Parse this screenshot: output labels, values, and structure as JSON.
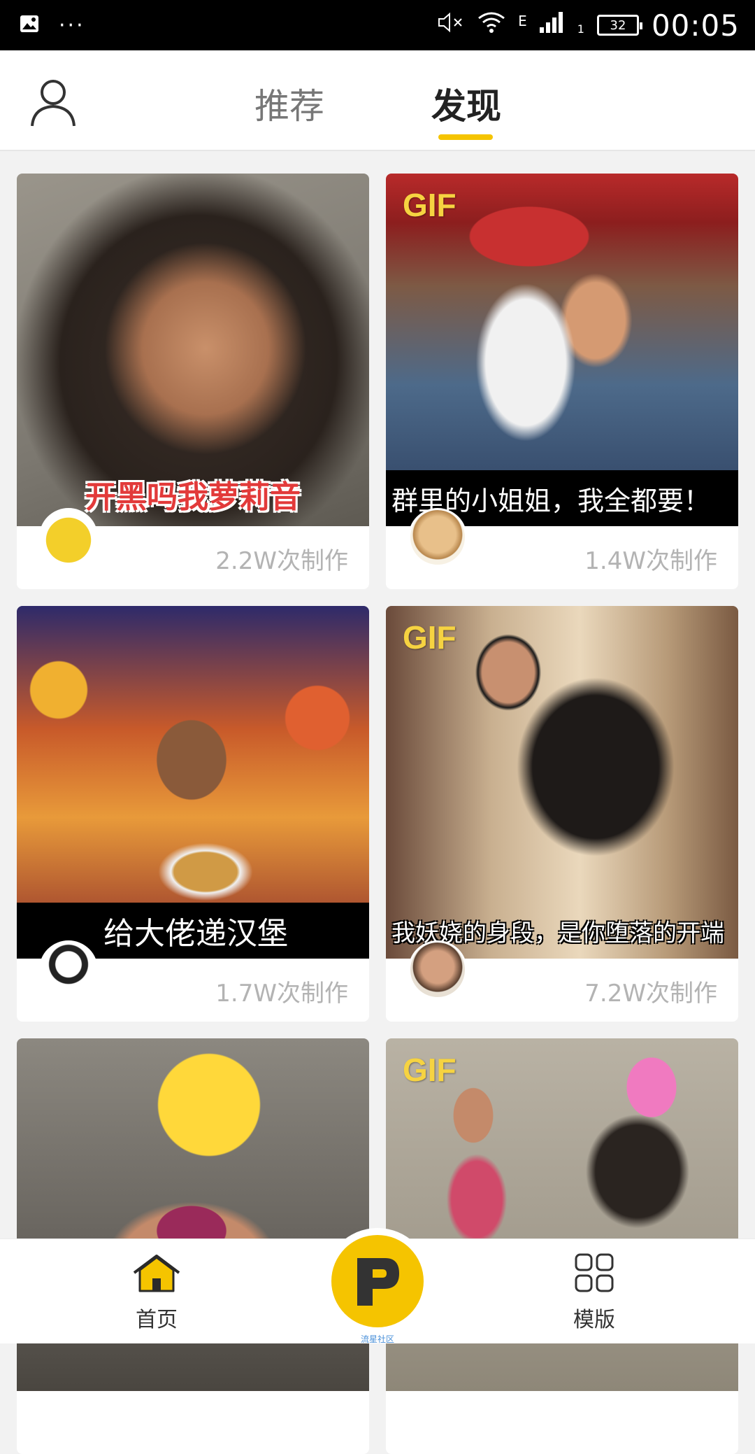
{
  "status_bar": {
    "time": "00:05",
    "battery": "32",
    "network": "E",
    "sim": "1",
    "dots": "···"
  },
  "top_nav": {
    "tabs": [
      {
        "label": "推荐"
      },
      {
        "label": "发现"
      }
    ],
    "active_tab": "发现"
  },
  "cards": [
    {
      "gif": false,
      "caption": "开黑吗我萝莉音",
      "count": "2.2W次制作"
    },
    {
      "gif": true,
      "gif_label": "GIF",
      "caption": "群里的小姐姐，我全都要！",
      "count": "1.4W次制作"
    },
    {
      "gif": false,
      "caption": "给大佬递汉堡",
      "count": "1.7W次制作"
    },
    {
      "gif": true,
      "gif_label": "GIF",
      "caption": "我妖娆的身段，是你堕落的开端",
      "count": "7.2W次制作"
    },
    {
      "gif": false,
      "caption": "",
      "count": ""
    },
    {
      "gif": true,
      "gif_label": "GIF",
      "caption": "",
      "count": ""
    }
  ],
  "bottom_nav": {
    "home_label": "首页",
    "center_label": "流星社区",
    "template_label": "模版"
  },
  "colors": {
    "accent": "#f5c400",
    "background": "#f2f2f2",
    "count_text": "#b3b3b3"
  }
}
